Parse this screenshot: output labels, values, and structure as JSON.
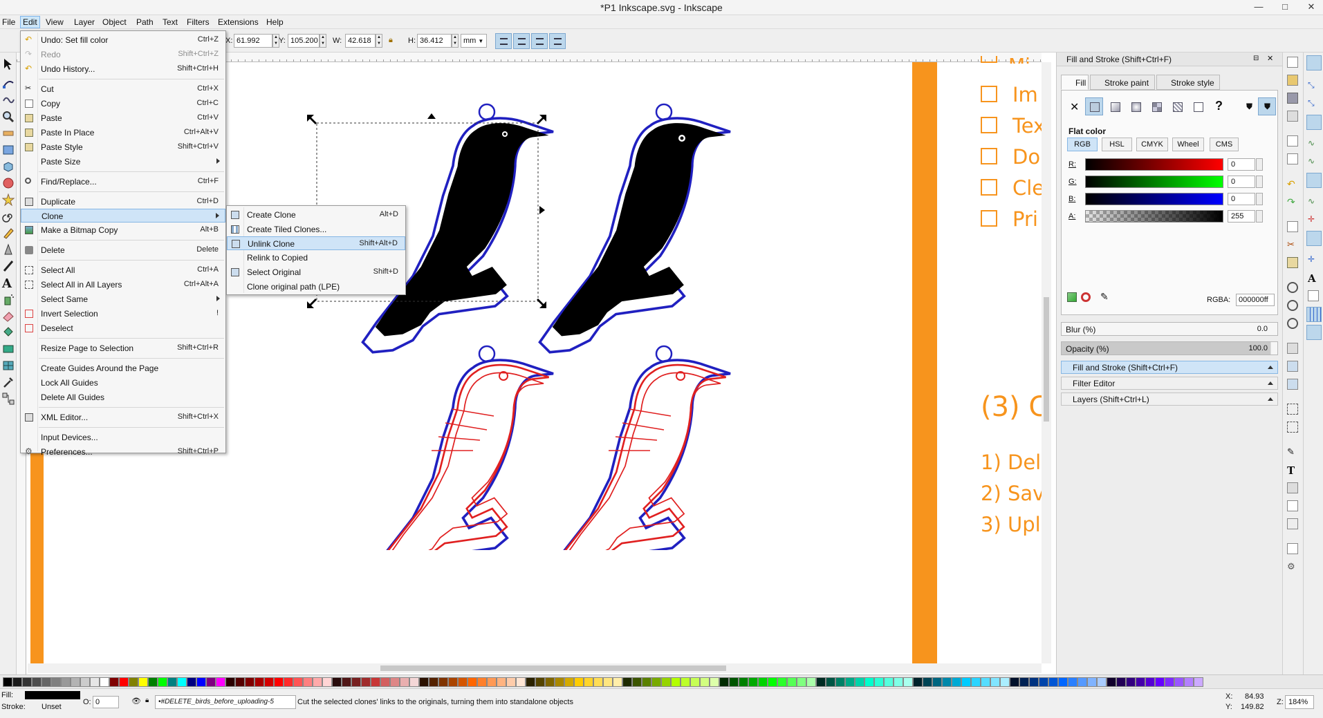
{
  "window": {
    "title": "*P1 Inkscape.svg - Inkscape"
  },
  "menubar": [
    "File",
    "Edit",
    "View",
    "Layer",
    "Object",
    "Path",
    "Text",
    "Filters",
    "Extensions",
    "Help"
  ],
  "toolbar": {
    "x_label": "X:",
    "x_value": "61.992",
    "y_label": "Y:",
    "y_value": "105.200",
    "w_label": "W:",
    "w_value": "42.618",
    "h_label": "H:",
    "h_value": "36.412",
    "unit": "mm"
  },
  "edit_menu": [
    {
      "label": "Undo: Set fill color",
      "shortcut": "Ctrl+Z"
    },
    {
      "label": "Redo",
      "shortcut": "Shift+Ctrl+Z",
      "disabled": true
    },
    {
      "label": "Undo History...",
      "shortcut": "Shift+Ctrl+H"
    },
    {
      "label": "Cut",
      "shortcut": "Ctrl+X"
    },
    {
      "label": "Copy",
      "shortcut": "Ctrl+C"
    },
    {
      "label": "Paste",
      "shortcut": "Ctrl+V"
    },
    {
      "label": "Paste In Place",
      "shortcut": "Ctrl+Alt+V"
    },
    {
      "label": "Paste Style",
      "shortcut": "Shift+Ctrl+V"
    },
    {
      "label": "Paste Size",
      "shortcut": ""
    },
    {
      "label": "Find/Replace...",
      "shortcut": "Ctrl+F"
    },
    {
      "label": "Duplicate",
      "shortcut": "Ctrl+D"
    },
    {
      "label": "Clone",
      "shortcut": ""
    },
    {
      "label": "Make a Bitmap Copy",
      "shortcut": "Alt+B"
    },
    {
      "label": "Delete",
      "shortcut": "Delete"
    },
    {
      "label": "Select All",
      "shortcut": "Ctrl+A"
    },
    {
      "label": "Select All in All Layers",
      "shortcut": "Ctrl+Alt+A"
    },
    {
      "label": "Select Same",
      "shortcut": ""
    },
    {
      "label": "Invert Selection",
      "shortcut": "!"
    },
    {
      "label": "Deselect",
      "shortcut": ""
    },
    {
      "label": "Resize Page to Selection",
      "shortcut": "Shift+Ctrl+R"
    },
    {
      "label": "Create Guides Around the Page",
      "shortcut": ""
    },
    {
      "label": "Lock All Guides",
      "shortcut": ""
    },
    {
      "label": "Delete All Guides",
      "shortcut": ""
    },
    {
      "label": "XML Editor...",
      "shortcut": "Shift+Ctrl+X"
    },
    {
      "label": "Input Devices...",
      "shortcut": ""
    },
    {
      "label": "Preferences...",
      "shortcut": "Shift+Ctrl+P"
    }
  ],
  "clone_submenu": [
    {
      "label": "Create Clone",
      "shortcut": "Alt+D"
    },
    {
      "label": "Create Tiled Clones...",
      "shortcut": ""
    },
    {
      "label": "Unlink Clone",
      "shortcut": "Shift+Alt+D"
    },
    {
      "label": "Relink to Copied",
      "shortcut": ""
    },
    {
      "label": "Select Original",
      "shortcut": "Shift+D"
    },
    {
      "label": "Clone original path (LPE)",
      "shortcut": ""
    }
  ],
  "document_text": {
    "checklist": [
      "Mi",
      "Im",
      "Tex",
      "Do",
      "Cle",
      "Pri"
    ],
    "heading": "(3) C",
    "steps": [
      "1) Del",
      "2) Sav",
      "3) Upl"
    ]
  },
  "fill_stroke": {
    "title": "Fill and Stroke (Shift+Ctrl+F)",
    "tabs": [
      "Fill",
      "Stroke paint",
      "Stroke style"
    ],
    "flat_color": "Flat color",
    "modes": [
      "RGB",
      "HSL",
      "CMYK",
      "Wheel",
      "CMS"
    ],
    "channels": [
      {
        "label": "R:",
        "value": "0"
      },
      {
        "label": "G:",
        "value": "0"
      },
      {
        "label": "B:",
        "value": "0"
      },
      {
        "label": "A:",
        "value": "255"
      }
    ],
    "rgba_label": "RGBA:",
    "rgba_value": "000000ff",
    "blur_label": "Blur (%)",
    "blur_value": "0.0",
    "opacity_label": "Opacity (%)",
    "opacity_value": "100.0"
  },
  "docked_dialogs": [
    "Fill and Stroke (Shift+Ctrl+F)",
    "Filter Editor",
    "Layers (Shift+Ctrl+L)"
  ],
  "status": {
    "fill_label": "Fill:",
    "stroke_label": "Stroke:",
    "stroke_value": "Unset",
    "opacity_label": "O:",
    "opacity_value": "0",
    "layer": "•#DELETE_birds_before_uploading-5",
    "message": "Cut the selected clones' links to the originals, turning them into standalone objects",
    "coord_x_label": "X:",
    "coord_x": "84.93",
    "coord_y_label": "Y:",
    "coord_y": "149.82",
    "zoom_label": "Z:",
    "zoom": "184%"
  },
  "colors": {
    "accent_orange": "#f7941d",
    "bird_outline": "#2020c0",
    "bird_detail": "#e02020",
    "highlight": "#cfe4f7"
  }
}
